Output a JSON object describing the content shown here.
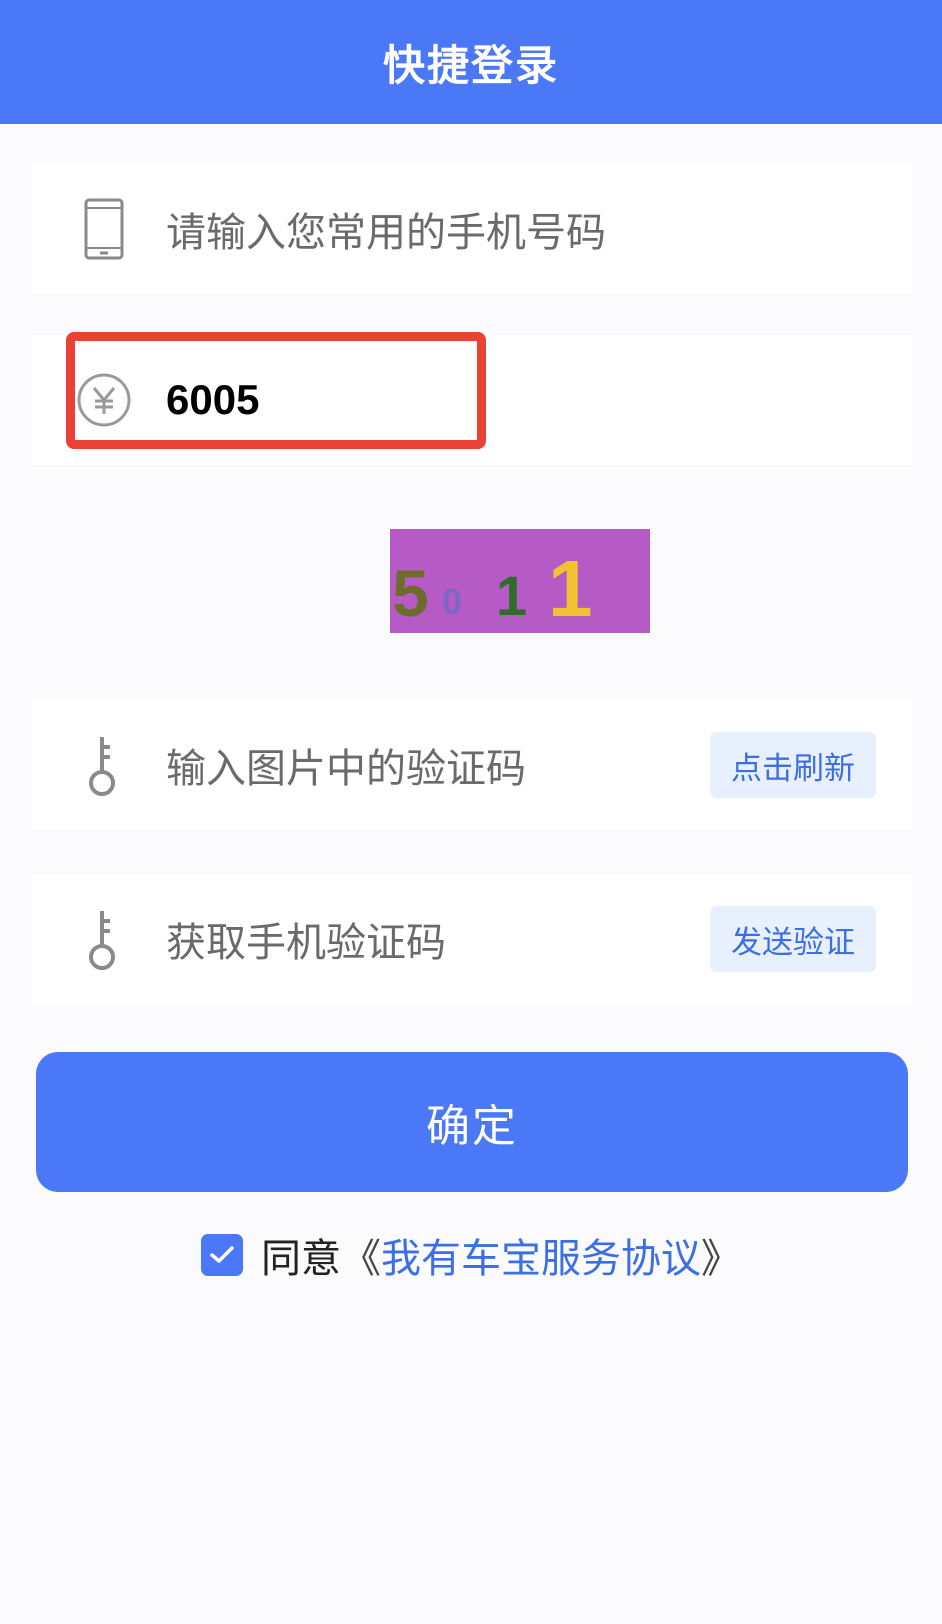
{
  "header": {
    "title": "快捷登录"
  },
  "phone": {
    "placeholder": "请输入您常用的手机号码",
    "icon": "phone-icon"
  },
  "amount": {
    "value": "6005",
    "icon": "yen-circle-icon"
  },
  "captcha_image": {
    "chars": [
      "5",
      "0",
      "1",
      "1"
    ],
    "background": "#b65bc6"
  },
  "image_code": {
    "placeholder": "输入图片中的验证码",
    "button": "点击刷新",
    "icon": "key-icon"
  },
  "sms_code": {
    "placeholder": "获取手机验证码",
    "button": "发送验证",
    "icon": "key-icon"
  },
  "confirm": {
    "label": "确定"
  },
  "agreement": {
    "checked": true,
    "prefix": "同意",
    "open_bracket": "《",
    "link": "我有车宝服务协议",
    "close_bracket": "》"
  },
  "colors": {
    "accent": "#4a78f7",
    "highlight": "#ea4335",
    "link": "#3c6fe6"
  }
}
